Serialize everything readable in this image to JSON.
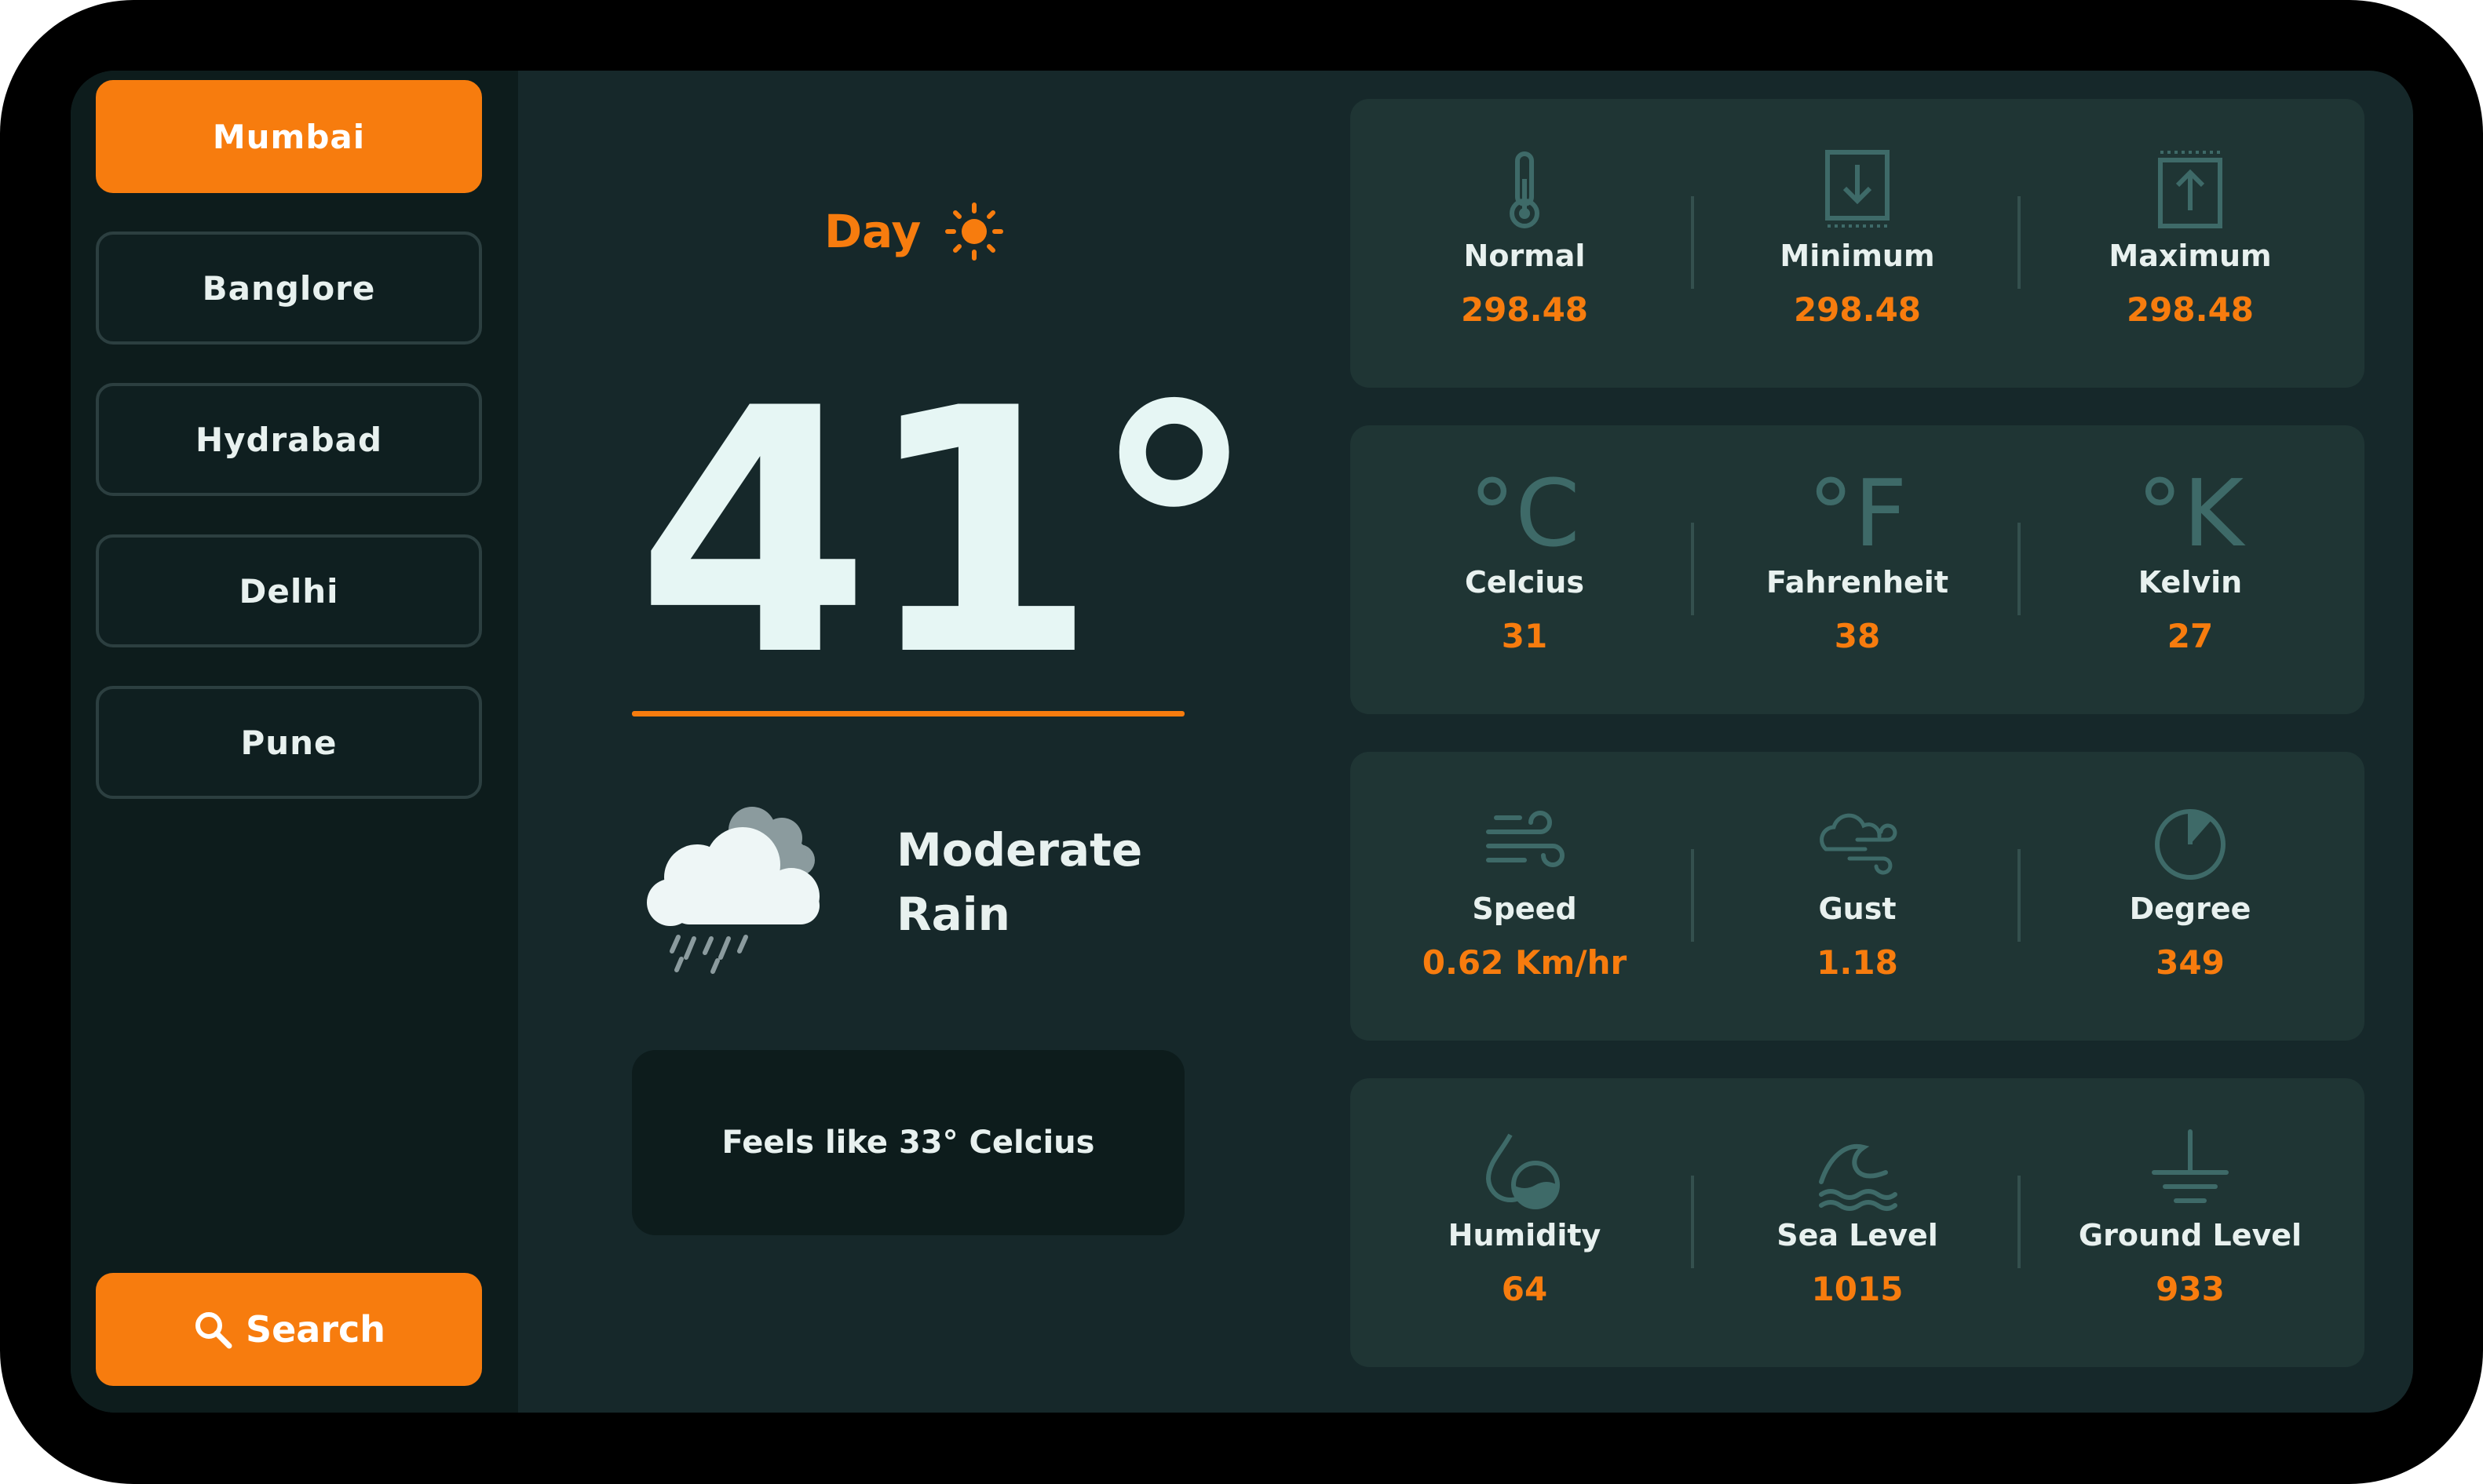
{
  "sidebar": {
    "cities": [
      {
        "label": "Mumbai",
        "active": true
      },
      {
        "label": "Banglore",
        "active": false
      },
      {
        "label": "Hydrabad",
        "active": false
      },
      {
        "label": "Delhi",
        "active": false
      },
      {
        "label": "Pune",
        "active": false
      }
    ],
    "search_label": "Search",
    "search_icon": "search-icon"
  },
  "main": {
    "period_label": "Day",
    "period_icon": "sun-icon",
    "temperature": "41°",
    "condition_line1": "Moderate",
    "condition_line2": "Rain",
    "condition_icon": "rain-cloud-icon",
    "feels_like": "Feels like 33° Celcius"
  },
  "temperature_card": {
    "normal": {
      "label": "Normal",
      "value": "298.48",
      "icon": "thermometer-icon"
    },
    "minimum": {
      "label": "Minimum",
      "value": "298.48",
      "icon": "download-arrow-icon"
    },
    "maximum": {
      "label": "Maximum",
      "value": "298.48",
      "icon": "upload-arrow-icon"
    }
  },
  "units_card": {
    "celsius": {
      "label": "Celcius",
      "value": "31",
      "symbol": "°C"
    },
    "fahrenheit": {
      "label": "Fahrenheit",
      "value": "38",
      "symbol": "°F"
    },
    "kelvin": {
      "label": "Kelvin",
      "value": "27",
      "symbol": "°K"
    }
  },
  "wind_card": {
    "speed": {
      "label": "Speed",
      "value": "0.62 Km/hr",
      "icon": "wind-icon"
    },
    "gust": {
      "label": "Gust",
      "value": "1.18",
      "icon": "cloud-wind-icon"
    },
    "degree": {
      "label": "Degree",
      "value": "349",
      "icon": "gauge-icon"
    }
  },
  "levels_card": {
    "humidity": {
      "label": "Humidity",
      "value": "64",
      "icon": "humidity-icon"
    },
    "sea_level": {
      "label": "Sea Level",
      "value": "1015",
      "icon": "wave-icon"
    },
    "ground_level": {
      "label": "Ground Level",
      "value": "933",
      "icon": "ground-icon"
    }
  },
  "colors": {
    "accent": "#f77c0e",
    "background": "#16282a",
    "sidebar": "#0d1c1c",
    "card": "#1f3534",
    "icon": "#3e6a68",
    "text": "#e8f1ef"
  }
}
